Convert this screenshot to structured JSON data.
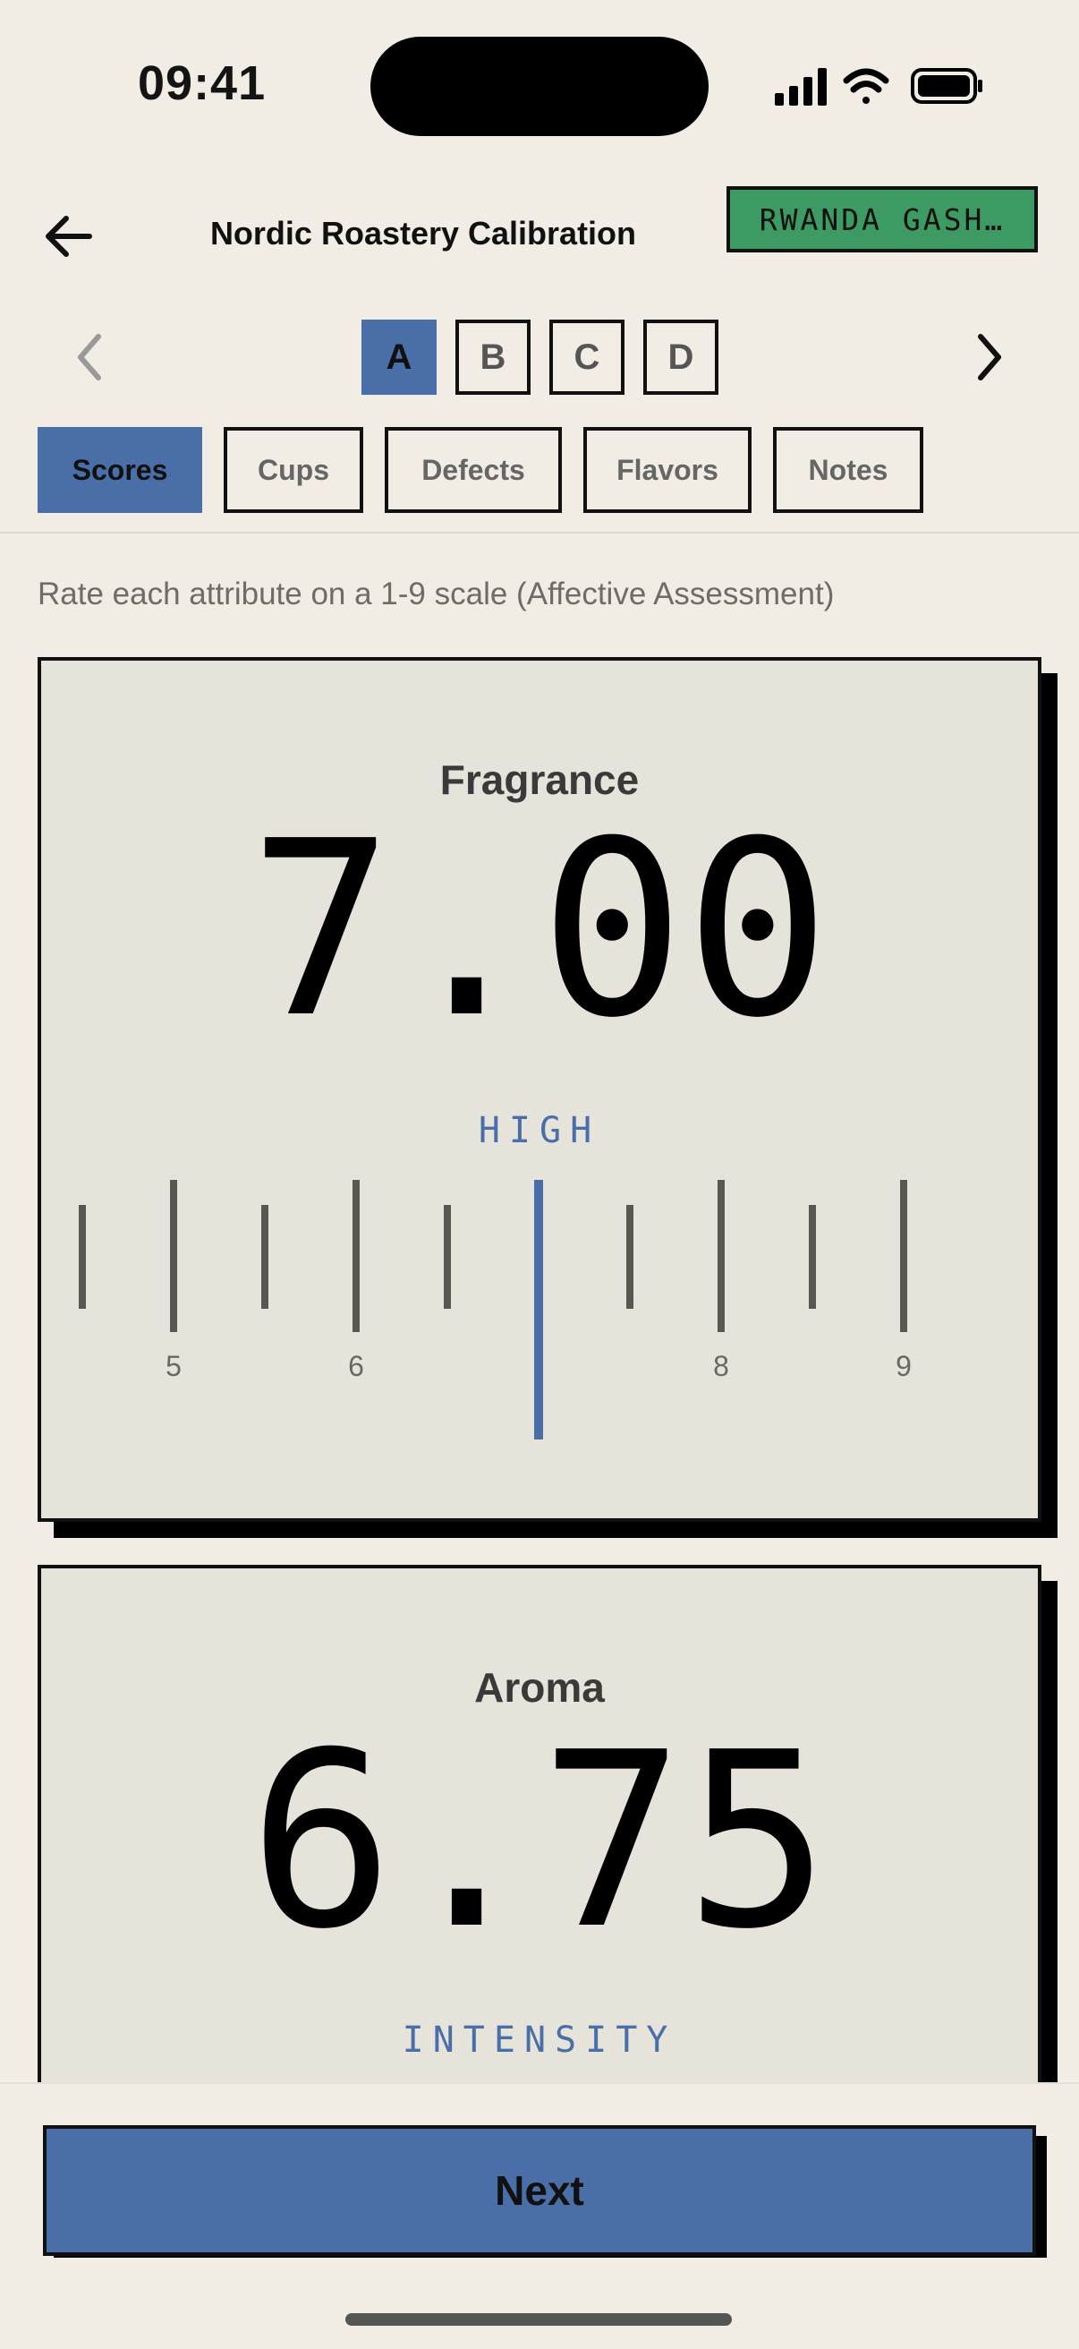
{
  "status_bar": {
    "time": "09:41"
  },
  "header": {
    "title": "Nordic Roastery Calibration",
    "coffee_badge": "RWANDA GASH…"
  },
  "samples": {
    "items": [
      "A",
      "B",
      "C",
      "D"
    ],
    "active": "A"
  },
  "tabs": {
    "items": [
      "Scores",
      "Cups",
      "Defects",
      "Flavors",
      "Notes"
    ],
    "active": "Scores"
  },
  "instructions": "Rate each attribute on a 1-9 scale (Affective Assessment)",
  "attributes": [
    {
      "name": "Fragrance",
      "score": "7.00",
      "level": "HIGH",
      "slider": {
        "value": 7.0,
        "visible_min": 4.5,
        "visible_max": 9.0,
        "labels": [
          "5",
          "6",
          "8",
          "9"
        ]
      }
    },
    {
      "name": "Aroma",
      "score": "6.75",
      "level": "INTENSITY"
    }
  ],
  "footer": {
    "next_label": "Next"
  },
  "colors": {
    "background": "#f1ede4",
    "card": "#e6e3da",
    "accent_blue": "#4a6fa8",
    "badge_green": "#3e9a63"
  }
}
